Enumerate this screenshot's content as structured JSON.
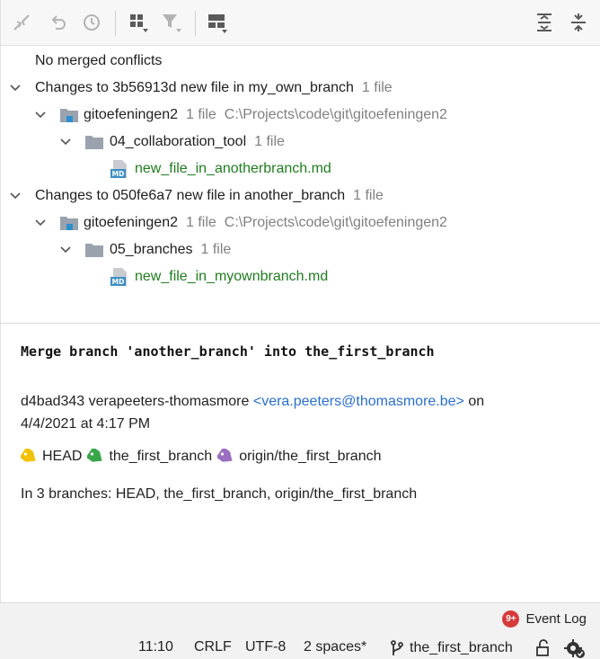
{
  "toolbar": {
    "buttons": [
      {
        "icon": "merge-arrows-icon"
      },
      {
        "icon": "undo-icon"
      },
      {
        "icon": "history-clock-icon"
      },
      {
        "icon": "group-by-icon"
      },
      {
        "icon": "filter-icon"
      },
      {
        "icon": "layout-icon"
      },
      {
        "icon": "expand-all-icon"
      },
      {
        "icon": "collapse-all-icon"
      }
    ]
  },
  "tree": {
    "no_conflicts": "No merged conflicts",
    "groups": [
      {
        "title": "Changes to 3b56913d new file in my_own_branch",
        "count": "1 file",
        "repo": {
          "name": "gitoefeningen2",
          "count": "1 file",
          "path": "C:\\Projects\\code\\git\\gitoefeningen2"
        },
        "folder": {
          "name": "04_collaboration_tool",
          "count": "1 file"
        },
        "file": "new_file_in_anotherbranch.md"
      },
      {
        "title": "Changes to 050fe6a7 new file in another_branch",
        "count": "1 file",
        "repo": {
          "name": "gitoefeningen2",
          "count": "1 file",
          "path": "C:\\Projects\\code\\git\\gitoefeningen2"
        },
        "folder": {
          "name": "05_branches",
          "count": "1 file"
        },
        "file": "new_file_in_myownbranch.md"
      }
    ],
    "md_icon_label": "MD"
  },
  "details": {
    "message": "Merge branch 'another_branch' into the_first_branch",
    "hash": "d4bad343",
    "author": "verapeeters-thomasmore",
    "email": "<vera.peeters@thomasmore.be>",
    "on": "on",
    "date": "4/4/2021 at 4:17 PM",
    "refs": [
      {
        "label": "HEAD",
        "color": "#f2c200"
      },
      {
        "label": "the_first_branch",
        "color": "#3aa64a"
      },
      {
        "label": "origin/the_first_branch",
        "color": "#9a6fc2"
      }
    ],
    "branches": "In 3 branches: HEAD, the_first_branch, origin/the_first_branch"
  },
  "statusbar": {
    "event_badge": "9+",
    "event_log": "Event Log",
    "position": "11:10",
    "line_sep": "CRLF",
    "encoding": "UTF-8",
    "indent": "2 spaces*",
    "branch": "the_first_branch"
  }
}
